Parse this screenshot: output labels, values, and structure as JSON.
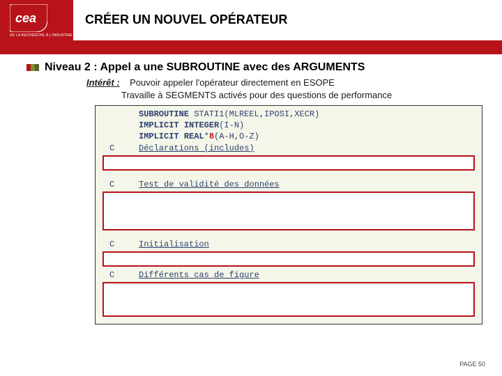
{
  "header": {
    "logo_caption": "DE LA RECHERCHE À L'INDUSTRIE",
    "title": "CRÉER UN NOUVEL OPÉRATEUR"
  },
  "section": {
    "heading": "Niveau 2 : Appel a une SUBROUTINE avec des ARGUMENTS",
    "interet_label": "Intérêt :",
    "interet_line1": "Pouvoir appeler l'opérateur directement en ESOPE",
    "interet_line2": "Travaille à SEGMENTS activés pour des questions de performance"
  },
  "code": {
    "l1_kw": "SUBROUTINE",
    "l1_rest": " STATI1(MLREEL,IPOSI,XECR)",
    "l2_kw1": "IMPLICIT",
    "l2_kw2": "INTEGER",
    "l2_rest": "(I-N)",
    "l3_kw1": "IMPLICIT",
    "l3_kw2": "REAL",
    "l3_star": "*",
    "l3_num": "8",
    "l3_rest": "(A-H,O-Z)",
    "c1_col": "C",
    "c1_text": "Déclarations (includes)",
    "c2_col": "C",
    "c2_text": "Test de validité des données",
    "c3_col": "C",
    "c3_text": "Initialisation",
    "c4_col": "C",
    "c4_text": "Différents cas de figure"
  },
  "footer": {
    "page_label": "PAGE 50"
  }
}
